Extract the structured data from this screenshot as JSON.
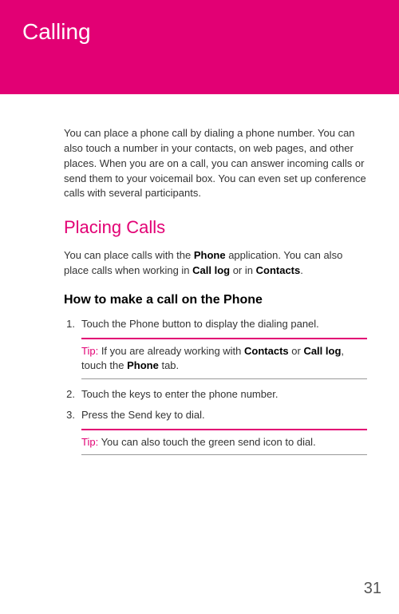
{
  "header": {
    "title": "Calling"
  },
  "intro": "You can place a phone call by dialing a phone number. You can also touch a number in your contacts, on web pages, and other places. When you are on a call, you can answer incoming calls or send them to your voicemail box. You can even set up conference calls with several participants.",
  "section": {
    "heading": "Placing Calls",
    "para_pre": "You can place calls with the ",
    "para_bold1": "Phone",
    "para_mid": " application. You can also place calls when working in ",
    "para_bold2": "Call log",
    "para_mid2": " or in ",
    "para_bold3": "Contacts",
    "para_end": "."
  },
  "subheading": "How to make a call on the Phone",
  "steps": {
    "s1": {
      "num": "1.",
      "text": "Touch the Phone button to display the dialing panel."
    },
    "s2": {
      "num": "2.",
      "text": "Touch the keys to enter the phone number."
    },
    "s3": {
      "num": "3.",
      "text": "Press the Send key to dial."
    }
  },
  "tip1": {
    "label": "Tip:",
    "pre": "  If you are already working with ",
    "b1": "Contacts",
    "mid1": " or ",
    "b2": "Call log",
    "mid2": ", touch the ",
    "b3": "Phone",
    "end": " tab."
  },
  "tip2": {
    "label": "Tip:",
    "text": "  You can also touch the green send icon to dial."
  },
  "page_number": "31"
}
